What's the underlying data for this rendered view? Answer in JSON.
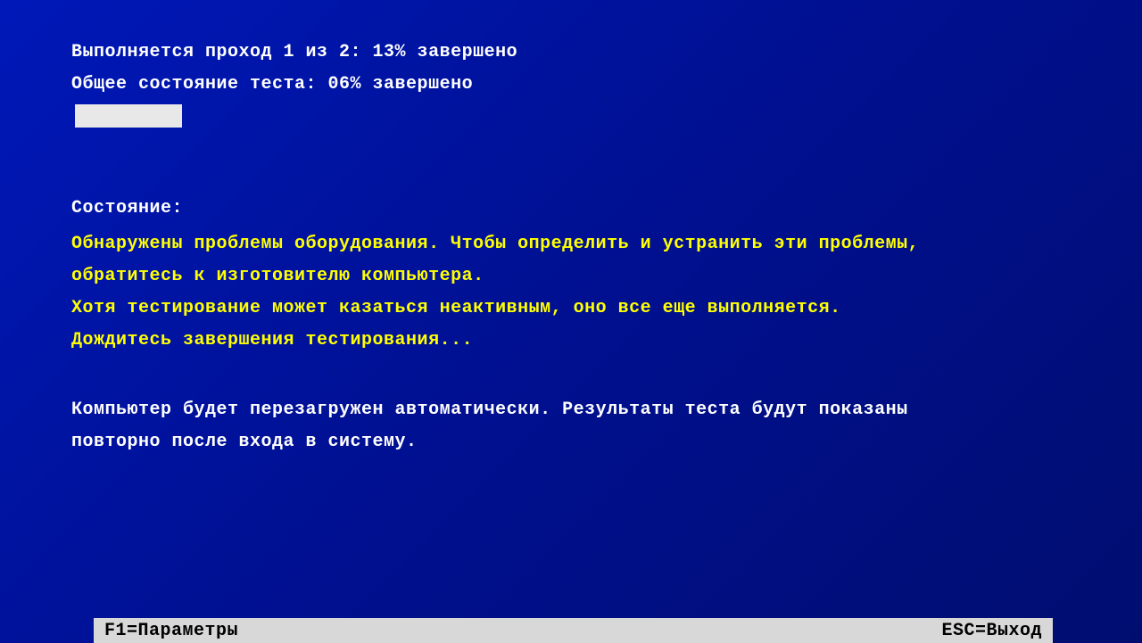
{
  "progress": {
    "pass_line": "Выполняется проход  1 из  2: 13% завершено",
    "overall_line": "Общее состояние теста: 06% завершено",
    "fill_percent": 6
  },
  "status": {
    "heading": "Состояние:",
    "warning_line1": "Обнаружены проблемы оборудования.  Чтобы определить и устранить эти проблемы,",
    "warning_line2": "обратитесь к изготовителю компьютера.",
    "warning_line3": "Хотя тестирование может казаться неактивным, оно все еще выполняется.",
    "warning_line4": "Дождитесь завершения тестирования...",
    "info_line1": "Компьютер будет перезагружен автоматически. Результаты теста будут показаны",
    "info_line2": "повторно после входа в систему."
  },
  "hotkeys": {
    "f1_label": "F1=Параметры",
    "esc_label": "ESC=Выход"
  }
}
